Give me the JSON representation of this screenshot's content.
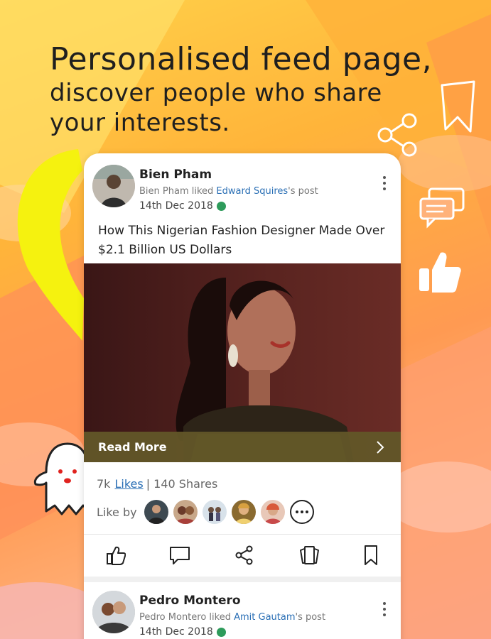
{
  "headline": {
    "line1": "Personalised feed page,",
    "line2": "discover people who share",
    "line3": "your interests."
  },
  "post1": {
    "author": "Bien Pham",
    "activity_prefix": "Bien Pham liked ",
    "activity_link": "Edward Squires",
    "activity_suffix": "'s post",
    "date": "14th Dec 2018",
    "title": "How This Nigerian Fashion Designer Made Over $2.1 Billion US Dollars",
    "read_more": "Read More",
    "likes_count": "7k",
    "likes_label": "Likes",
    "shares": "| 140 Shares",
    "like_by_label": "Like by"
  },
  "post2": {
    "author": "Pedro Montero",
    "activity_prefix": "Pedro Montero liked ",
    "activity_link": "Amit Gautam",
    "activity_suffix": "'s post",
    "date": "14th Dec 2018"
  },
  "icons": [
    "thumbs-up-icon",
    "comment-icon",
    "share-icon",
    "cards-icon",
    "bookmark-icon",
    "globe-icon",
    "kebab-menu-icon",
    "chevron-right-icon",
    "more-icon",
    "ghost-icon"
  ],
  "colors": {
    "link": "#2a6fb5",
    "read_more_bar": "#625628",
    "text_dark": "#222222"
  }
}
